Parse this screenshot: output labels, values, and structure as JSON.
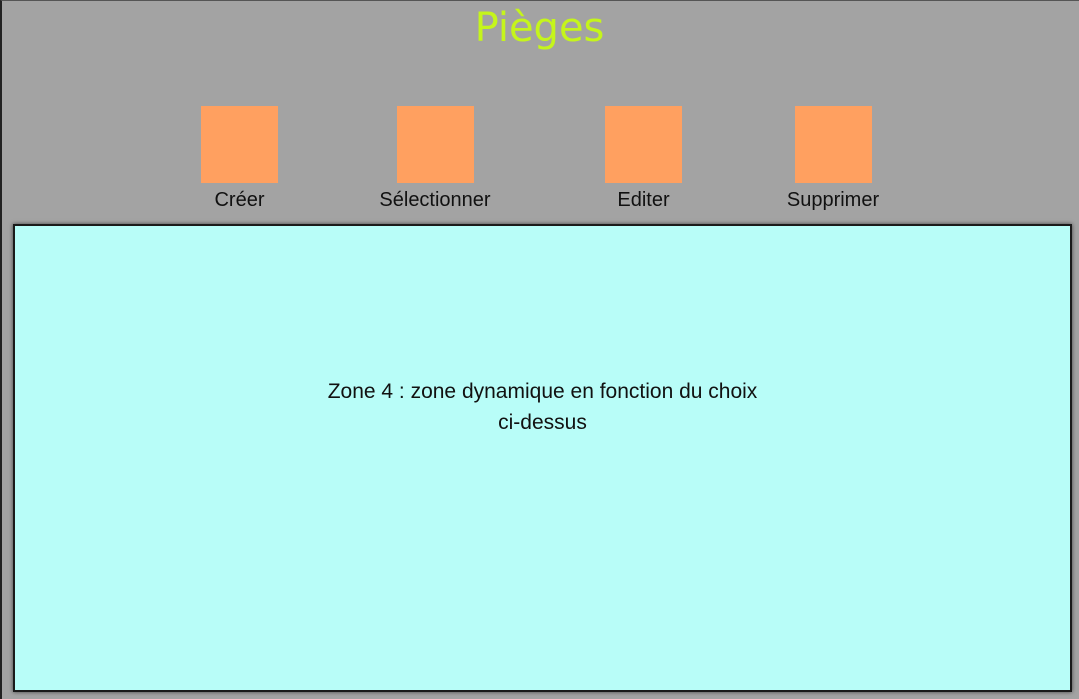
{
  "header": {
    "title": "Pièges"
  },
  "toolbar": {
    "create_label": "Créer",
    "select_label": "Sélectionner",
    "edit_label": "Editer",
    "delete_label": "Supprimer"
  },
  "zone": {
    "line1": "Zone 4 : zone dynamique en fonction du choix",
    "line2": "ci-dessus"
  },
  "colors": {
    "background": "#a3a3a3",
    "title": "#c5f51b",
    "button": "#ffa060",
    "zone": "#b8fdf8"
  }
}
